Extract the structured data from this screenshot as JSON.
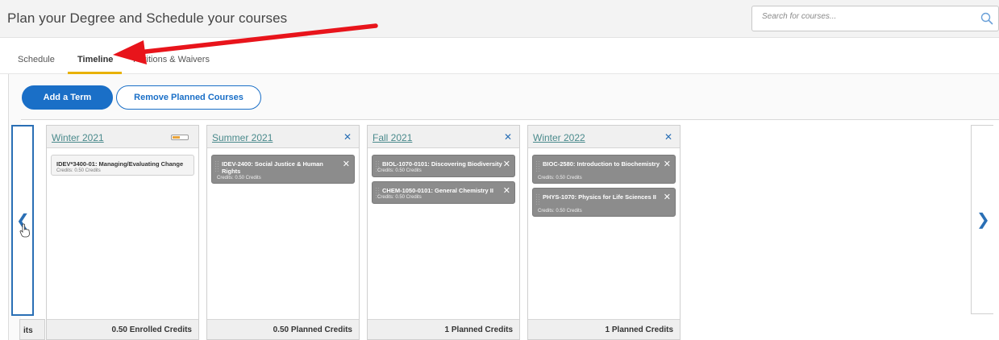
{
  "header": {
    "title": "Plan your Degree and Schedule your courses"
  },
  "search": {
    "placeholder": "Search for courses..."
  },
  "tabs": [
    {
      "label": "Schedule"
    },
    {
      "label": "Timeline",
      "active": true
    },
    {
      "label": "Petitions & Waivers"
    }
  ],
  "actions": {
    "add_term_label": "Add a Term",
    "remove_planned_label": "Remove Planned Courses"
  },
  "stub": {
    "footer_text": "its"
  },
  "terms": [
    {
      "name": "Winter 2021",
      "progress": 0.5,
      "courses": [
        {
          "title": "IDEV*3400-01: Managing/Evaluating Change",
          "credits": "Credits: 0.50 Credits",
          "status": "enrolled"
        }
      ],
      "footer": "0.50 Enrolled Credits"
    },
    {
      "name": "Summer 2021",
      "courses": [
        {
          "title": "IDEV-2400: Social Justice & Human Rights",
          "credits": "Credits: 0.50 Credits",
          "status": "planned"
        }
      ],
      "footer": "0.50 Planned Credits"
    },
    {
      "name": "Fall 2021",
      "courses": [
        {
          "title": "BIOL-1070-0101: Discovering Biodiversity",
          "credits": "Credits: 0.50 Credits",
          "status": "planned"
        },
        {
          "title": "CHEM-1050-0101: General Chemistry II",
          "credits": "Credits: 0.50 Credits",
          "status": "planned"
        }
      ],
      "footer": "1 Planned Credits"
    },
    {
      "name": "Winter 2022",
      "courses": [
        {
          "title": "BIOC-2580: Introduction to Biochemistry",
          "credits": "Credits: 0.50 Credits",
          "status": "planned"
        },
        {
          "title": "PHYS-1070: Physics for Life Sciences II",
          "credits": "Credits: 0.50 Credits",
          "status": "planned"
        }
      ],
      "footer": "1 Planned Credits"
    }
  ],
  "icons": {
    "search": "search-icon",
    "prev": "chevron-left-icon",
    "next": "chevron-right-icon",
    "close": "close-icon"
  },
  "colors": {
    "primary": "#1a6fc7",
    "tab_underline": "#e8b100",
    "planned_course": "#8c8c8c",
    "annotation_arrow": "#e8141b",
    "term_link": "#4a8a8c"
  }
}
